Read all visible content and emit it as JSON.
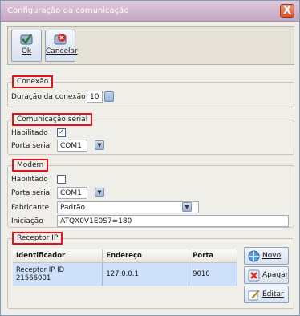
{
  "window": {
    "title": "Configuração da comunicação",
    "close_glyph": "X"
  },
  "toolbar": {
    "ok_label": "Ok",
    "cancel_label": "Cancelar"
  },
  "conexao": {
    "legend": "Conexão",
    "duration_label": "Duração da conexão",
    "duration_value": "10"
  },
  "serial": {
    "legend": "Comunicação serial",
    "enabled_label": "Habilitado",
    "enabled_checked": true,
    "check_glyph": "✓",
    "port_label": "Porta serial",
    "port_value": "COM1"
  },
  "modem": {
    "legend": "Modem",
    "enabled_label": "Habilitado",
    "enabled_checked": false,
    "port_label": "Porta serial",
    "port_value": "COM1",
    "maker_label": "Fabricante",
    "maker_value": "Padrão",
    "init_label": "Iniciação",
    "init_value": "ATQX0V1E0S7=180"
  },
  "receptor": {
    "legend": "Receptor IP",
    "columns": [
      "Identificador",
      "Endereço",
      "Porta"
    ],
    "rows": [
      [
        "Receptor IP ID 21566001",
        "127.0.0.1",
        "9010"
      ]
    ],
    "new_label": "Novo",
    "delete_label": "Apagar",
    "edit_label": "Editar"
  },
  "colors": {
    "highlight_border": "#e3101f",
    "title_bar": "#c6a8c3",
    "selected_row": "#cfe0fb"
  },
  "icons": {
    "ok": "check-icon",
    "cancel": "cancel-icon",
    "close": "close-icon",
    "new": "globe-add-icon",
    "delete": "delete-icon",
    "edit": "edit-icon"
  }
}
